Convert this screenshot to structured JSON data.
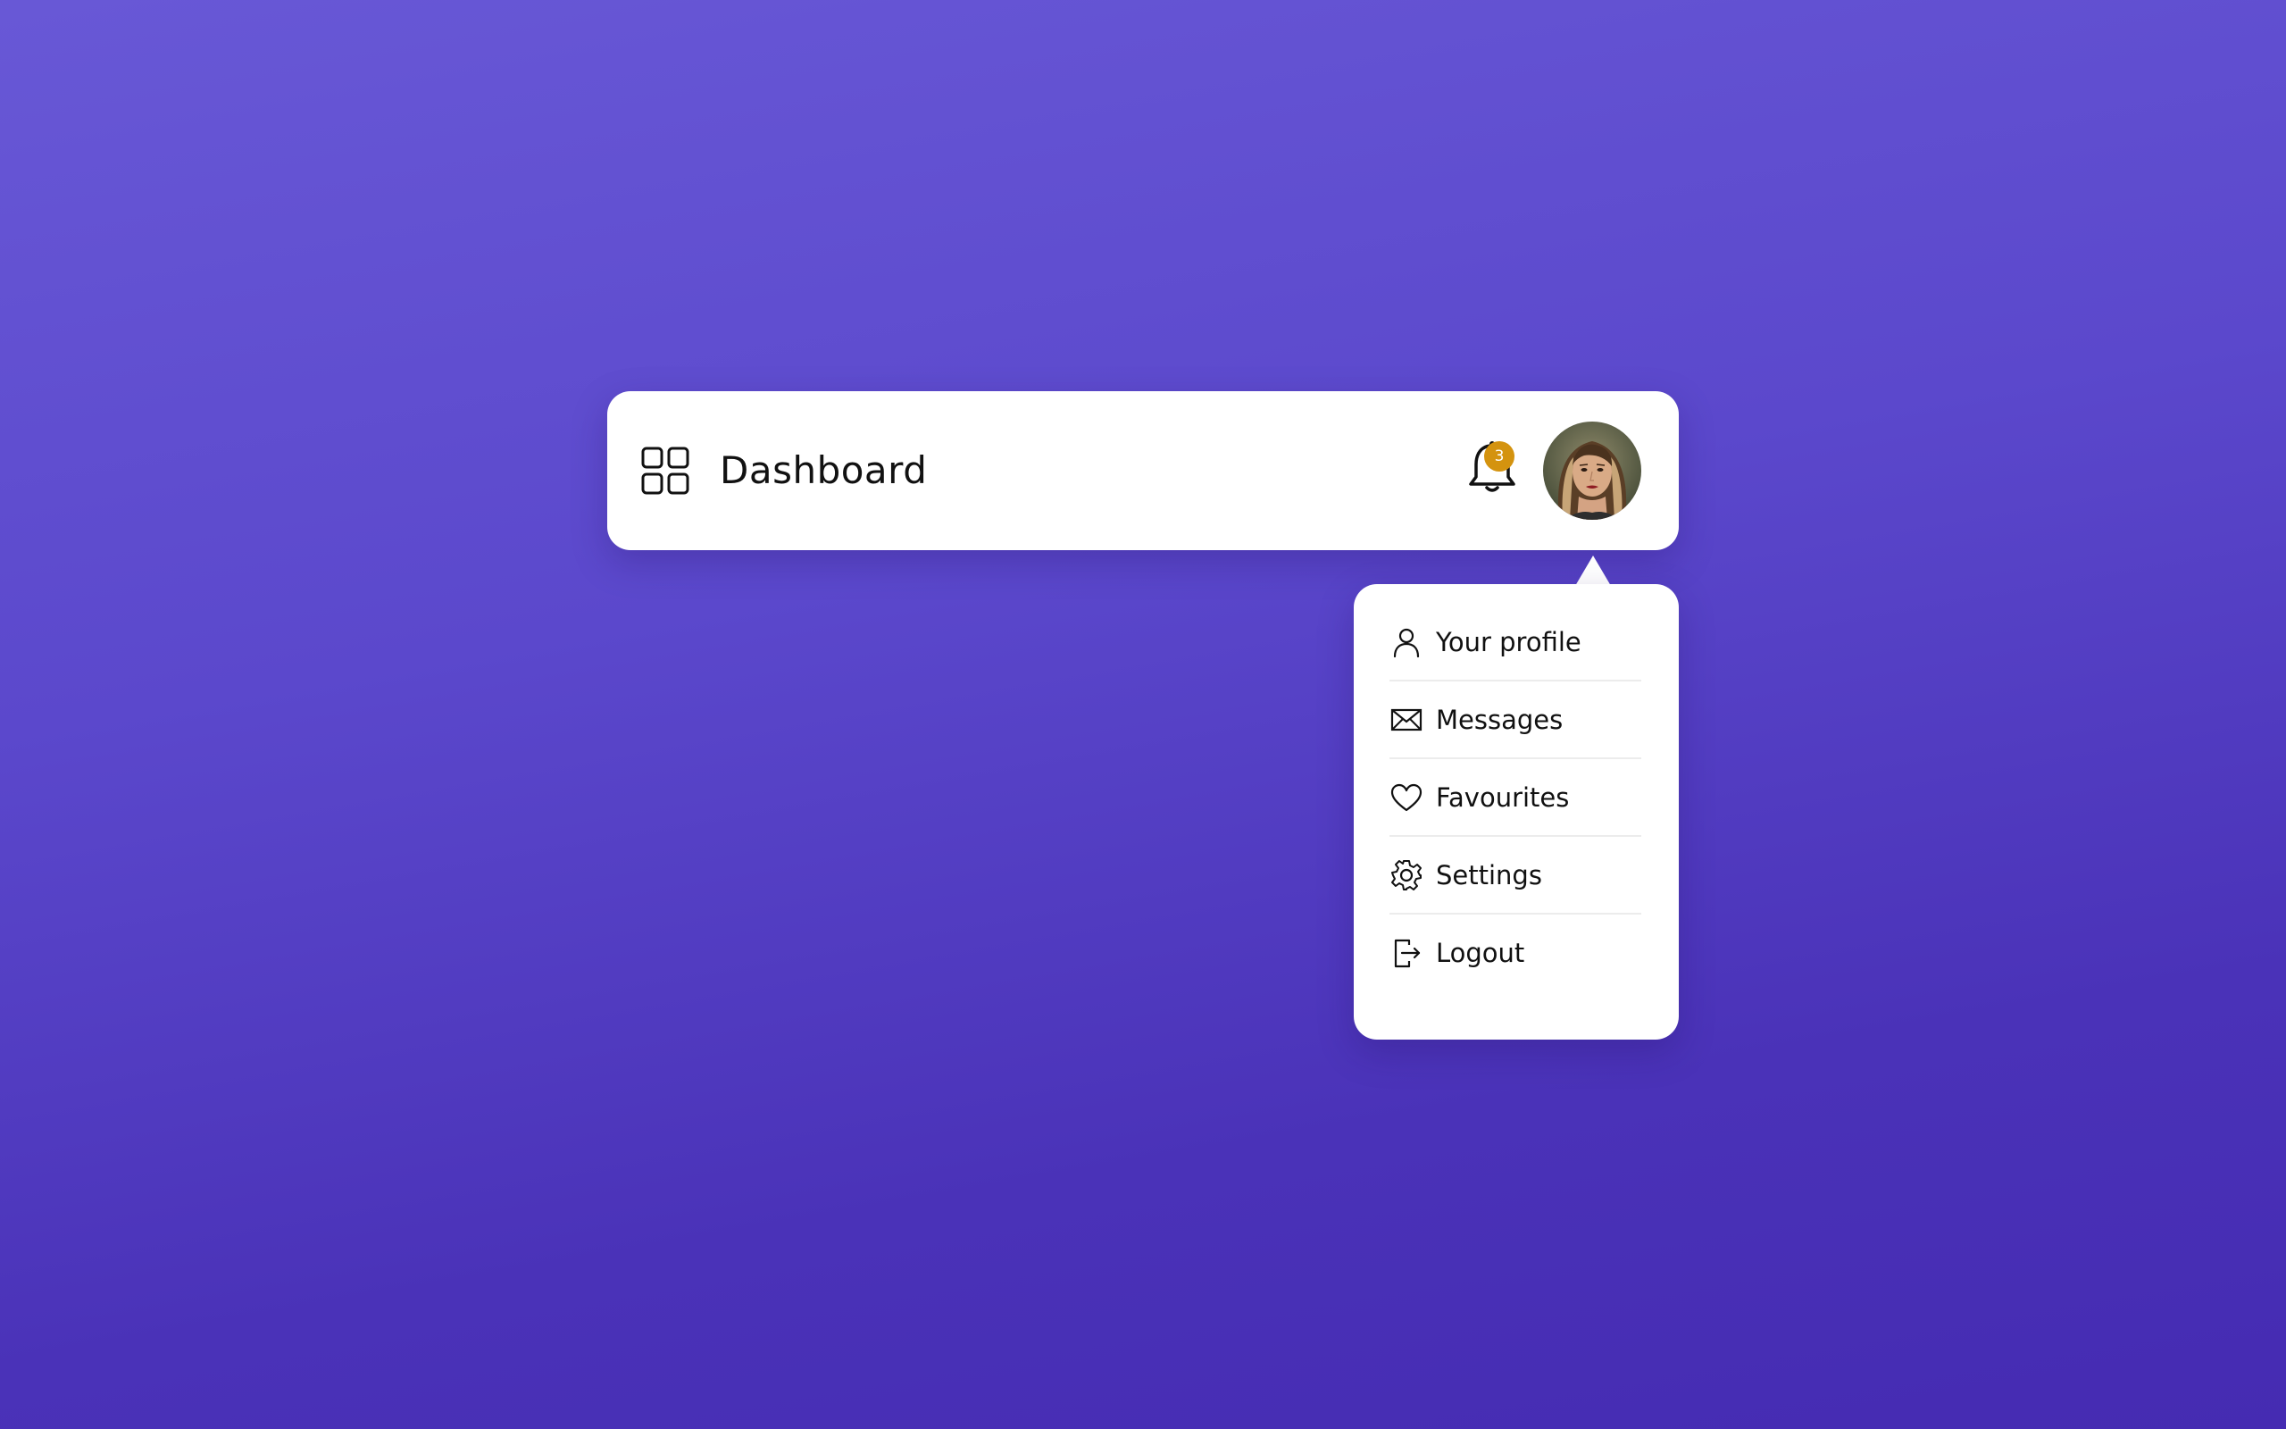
{
  "navbar": {
    "title": "Dashboard",
    "notifications": {
      "count": "3"
    },
    "avatar": {
      "alt": "User avatar"
    }
  },
  "menu": {
    "items": [
      {
        "label": "Your profile",
        "icon": "user-icon"
      },
      {
        "label": "Messages",
        "icon": "envelope-icon"
      },
      {
        "label": "Favourites",
        "icon": "heart-icon"
      },
      {
        "label": "Settings",
        "icon": "gear-icon"
      },
      {
        "label": "Logout",
        "icon": "logout-icon"
      }
    ]
  },
  "colors": {
    "background_top": "#6858d6",
    "background_bottom": "#452bb2",
    "badge": "#d4930f",
    "surface": "#ffffff",
    "text": "#111111"
  }
}
